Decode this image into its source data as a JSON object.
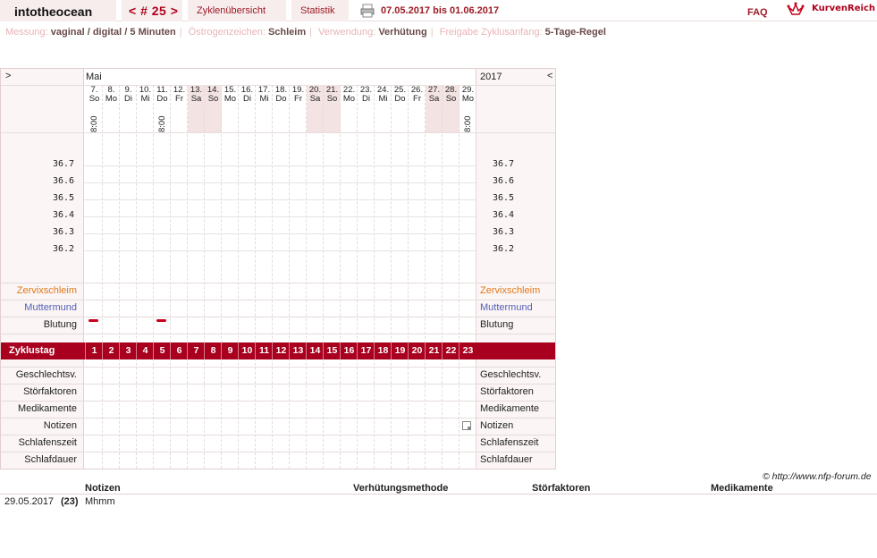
{
  "header": {
    "username": "intotheocean",
    "cycle": "< # 25 >",
    "overview_label": "Zyklenübersicht",
    "stats_label": "Statistik",
    "date_range": "07.05.2017 bis 01.06.2017",
    "faq_label": "FAQ",
    "logo_text": "KurvenReich"
  },
  "info": {
    "messung_label": "Messung:",
    "messung_value": "vaginal / digital / 5 Minuten",
    "oestrogen_label": "Östrogenzeichen:",
    "oestrogen_value": "Schleim",
    "verwendung_label": "Verwendung:",
    "verwendung_value": "Verhütung",
    "freigabe_label": "Freigabe Zyklusanfang:",
    "freigabe_value": "5-Tage-Regel"
  },
  "chart": {
    "nav_prev": ">",
    "nav_next": "<",
    "month": "Mai",
    "year": "2017",
    "days": [
      {
        "num": "7.",
        "dow": "So",
        "weekend": false,
        "time": "8:00"
      },
      {
        "num": "8.",
        "dow": "Mo",
        "weekend": false,
        "time": ""
      },
      {
        "num": "9.",
        "dow": "Di",
        "weekend": false,
        "time": ""
      },
      {
        "num": "10.",
        "dow": "Mi",
        "weekend": false,
        "time": ""
      },
      {
        "num": "11.",
        "dow": "Do",
        "weekend": false,
        "time": "8:00"
      },
      {
        "num": "12.",
        "dow": "Fr",
        "weekend": false,
        "time": ""
      },
      {
        "num": "13.",
        "dow": "Sa",
        "weekend": true,
        "time": ""
      },
      {
        "num": "14.",
        "dow": "So",
        "weekend": true,
        "time": ""
      },
      {
        "num": "15.",
        "dow": "Mo",
        "weekend": false,
        "time": ""
      },
      {
        "num": "16.",
        "dow": "Di",
        "weekend": false,
        "time": ""
      },
      {
        "num": "17.",
        "dow": "Mi",
        "weekend": false,
        "time": ""
      },
      {
        "num": "18.",
        "dow": "Do",
        "weekend": false,
        "time": ""
      },
      {
        "num": "19.",
        "dow": "Fr",
        "weekend": false,
        "time": ""
      },
      {
        "num": "20.",
        "dow": "Sa",
        "weekend": true,
        "time": ""
      },
      {
        "num": "21.",
        "dow": "So",
        "weekend": true,
        "time": ""
      },
      {
        "num": "22.",
        "dow": "Mo",
        "weekend": false,
        "time": ""
      },
      {
        "num": "23.",
        "dow": "Di",
        "weekend": false,
        "time": ""
      },
      {
        "num": "24.",
        "dow": "Mi",
        "weekend": false,
        "time": ""
      },
      {
        "num": "25.",
        "dow": "Do",
        "weekend": false,
        "time": ""
      },
      {
        "num": "26.",
        "dow": "Fr",
        "weekend": false,
        "time": ""
      },
      {
        "num": "27.",
        "dow": "Sa",
        "weekend": true,
        "time": ""
      },
      {
        "num": "28.",
        "dow": "So",
        "weekend": true,
        "time": ""
      },
      {
        "num": "29.",
        "dow": "Mo",
        "weekend": false,
        "time": "8:00"
      }
    ],
    "temps": [
      "36.7",
      "36.6",
      "36.5",
      "36.4",
      "36.3",
      "36.2"
    ],
    "rows_top": [
      {
        "label": "Zervixschleim",
        "color": "#e07a1a"
      },
      {
        "label": "Muttermund",
        "color": "#5560b8"
      },
      {
        "label": "Blutung",
        "color": "#222222"
      }
    ],
    "bleeding_days": [
      1,
      5
    ],
    "cycle_label": "Zyklustag",
    "cycle_days": [
      "1",
      "2",
      "3",
      "4",
      "5",
      "6",
      "7",
      "8",
      "9",
      "10",
      "11",
      "12",
      "13",
      "14",
      "15",
      "16",
      "17",
      "18",
      "19",
      "20",
      "21",
      "22",
      "23"
    ],
    "rows_bottom": [
      "Geschlechtsv.",
      "Störfaktoren",
      "Medikamente",
      "Notizen",
      "Schlafenszeit",
      "Schlafdauer"
    ],
    "note_day": 23
  },
  "footer": {
    "copyright": "© http://www.nfp-forum.de",
    "headers": [
      "Notizen",
      "Verhütungsmethode",
      "Störfaktoren",
      "Medikamente"
    ],
    "entry_date": "29.05.2017",
    "entry_day": "(23)",
    "entry_note": "Mhmm"
  },
  "colors": {
    "accent": "#a8001e",
    "weekend": "#f3e3e3"
  }
}
